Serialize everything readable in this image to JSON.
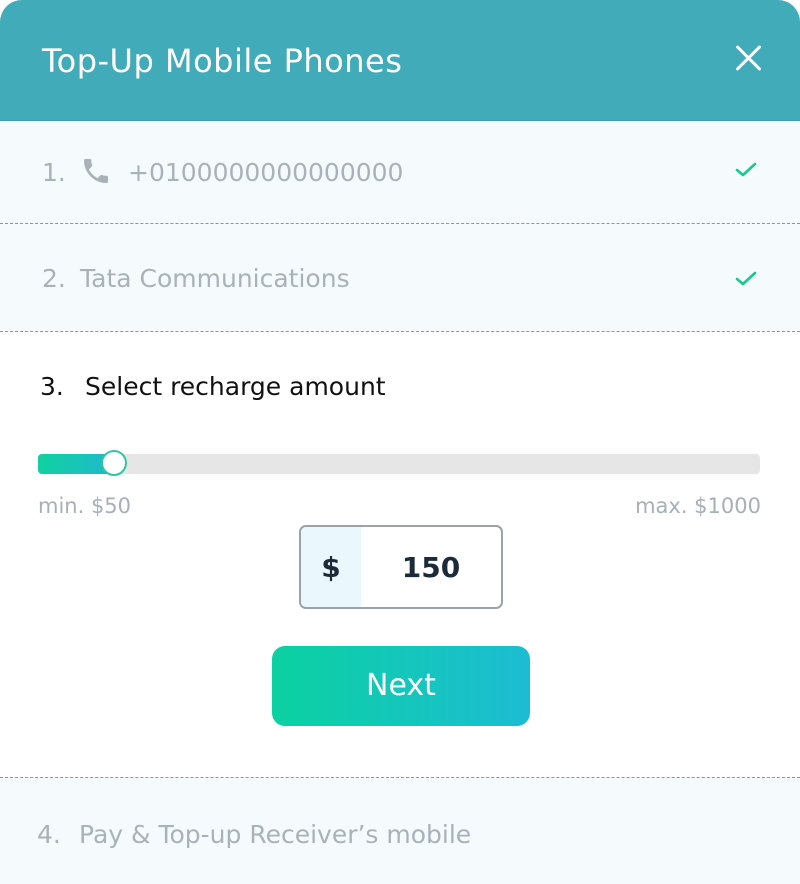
{
  "header": {
    "title": "Top-Up Mobile Phones",
    "close_icon": "close-icon"
  },
  "steps": {
    "phone": {
      "number": "1.",
      "icon": "phone-icon",
      "value": "+0100000000000000",
      "status_icon": "check-icon"
    },
    "operator": {
      "number": "2.",
      "value": "Tata Communications",
      "status_icon": "check-icon"
    },
    "amount": {
      "number": "3.",
      "label": "Select recharge amount",
      "slider": {
        "min": 50,
        "max": 1000,
        "value": 150
      },
      "min_label": "min. $50",
      "max_label": "max. $1000",
      "currency": "$",
      "amount_value": "150",
      "next_label": "Next"
    },
    "pay": {
      "number": "4.",
      "label": "Pay & Top-up Receiver’s mobile"
    }
  },
  "colors": {
    "header_bg": "#42abb9",
    "check": "#17c98f",
    "accent_start": "#0bd1a1",
    "accent_end": "#1dbcd3"
  }
}
